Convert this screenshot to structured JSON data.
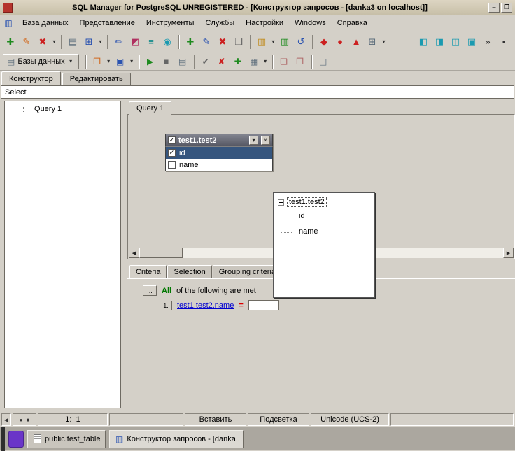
{
  "theme": {
    "face": "#d4d0c8",
    "titlebar-start": "#ddd5c2",
    "titlebar-end": "#c7bfa8",
    "header-bg1": "#82848f",
    "header-bg2": "#565864",
    "selection": "#35557e",
    "link": "#0000d0",
    "all-green": "#007700",
    "operator-red": "#dd0000",
    "taskbar": "#aba79f"
  },
  "window": {
    "title": "SQL Manager for PostgreSQL UNREGISTERED - [Конструктор запросов - [danka3 on localhost]]"
  },
  "glyphs": {
    "minimize": "–",
    "maximize": "❐",
    "mdi_window": "▥",
    "register_database": "✚",
    "registration_info": "✎",
    "unregister_database": "✖",
    "caret": "▾",
    "print": "▤",
    "windows_list": "⊞",
    "sql_editor": "✏",
    "query_builder": "◩",
    "sql_script": "≡",
    "sql_monitor": "◉",
    "create_object": "✚",
    "edit_object": "✎",
    "drop_object": "✖",
    "object_properties": "❏",
    "export_data": "▥",
    "import_data": "▥",
    "refresh": "↺",
    "grant_manager": "◆",
    "user_manager": "●",
    "role_manager": "▲",
    "table_list": "⊞",
    "backup_database": "◧",
    "restore_database": "◨",
    "copy_database": "◫",
    "db_services": "▣",
    "overflow": "»",
    "customize": "▪",
    "db_small": "▤",
    "open": "❐",
    "save": "▣",
    "execute": "▶",
    "stop": "■",
    "results": "▤",
    "commit": "✔",
    "rollback": "✘",
    "add_row": "✚",
    "grid_views": "▦",
    "copy_diagram": "❏",
    "save_diagram": "❐",
    "diagram_options": "◫",
    "scroll_left": "◀",
    "scroll_right": "▶",
    "check": "✓",
    "close_small": "×",
    "record_circle": "●",
    "record_square": "■",
    "status_arrow": "◀"
  },
  "menu": {
    "items": [
      "База данных",
      "Представление",
      "Инструменты",
      "Службы",
      "Настройки",
      "Windows",
      "Справка"
    ]
  },
  "toolbar_query": {
    "databases_label": "Базы данных"
  },
  "doc_tabs": {
    "designer": "Конструктор",
    "edit": "Редактировать"
  },
  "select_bar": {
    "text": "Select"
  },
  "subquery_tree": {
    "root": "Query 1"
  },
  "query_area": {
    "tab": "Query 1"
  },
  "table_widget": {
    "title": "test1.test2",
    "fields": [
      {
        "label": "id",
        "checked": true,
        "selected": true
      },
      {
        "label": "name",
        "checked": false,
        "selected": false
      }
    ]
  },
  "overlay_tree": {
    "root": "test1.test2",
    "children": [
      {
        "label": "id"
      },
      {
        "label": "name"
      }
    ]
  },
  "criteria": {
    "tabs": [
      {
        "label": "Criteria"
      },
      {
        "label": "Selection"
      },
      {
        "label": "Grouping criteria"
      }
    ],
    "dots": "...",
    "all": "All",
    "suffix": "of the following are met",
    "row_num": "1.",
    "field": "test1.test2.name",
    "operator": "=",
    "value": ""
  },
  "status": {
    "position": "1:  1",
    "insert": "Вставить",
    "highlight": "Подсветка",
    "encoding": "Unicode (UCS-2)"
  },
  "taskbar": {
    "items": [
      {
        "label": "public.test_table"
      },
      {
        "label": "Конструктор запросов - [danka..."
      }
    ]
  }
}
